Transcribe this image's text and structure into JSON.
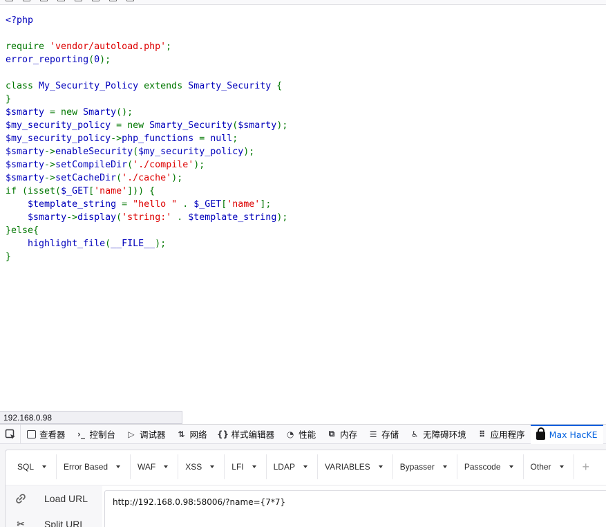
{
  "code_lines": [
    [
      {
        "c": "c-def",
        "t": "<?php"
      }
    ],
    [],
    [
      {
        "c": "c-kw",
        "t": "require "
      },
      {
        "c": "c-str",
        "t": "'vendor/autoload.php'"
      },
      {
        "c": "c-kw",
        "t": ";"
      }
    ],
    [
      {
        "c": "c-def",
        "t": "error_reporting"
      },
      {
        "c": "c-kw",
        "t": "("
      },
      {
        "c": "c-def",
        "t": "0"
      },
      {
        "c": "c-kw",
        "t": ");"
      }
    ],
    [],
    [
      {
        "c": "c-kw",
        "t": "class "
      },
      {
        "c": "c-def",
        "t": "My_Security_Policy "
      },
      {
        "c": "c-kw",
        "t": "extends "
      },
      {
        "c": "c-def",
        "t": "Smarty_Security "
      },
      {
        "c": "c-kw",
        "t": "{"
      }
    ],
    [
      {
        "c": "c-kw",
        "t": "}"
      }
    ],
    [
      {
        "c": "c-def",
        "t": "$smarty "
      },
      {
        "c": "c-kw",
        "t": "= new "
      },
      {
        "c": "c-def",
        "t": "Smarty"
      },
      {
        "c": "c-kw",
        "t": "();"
      }
    ],
    [
      {
        "c": "c-def",
        "t": "$my_security_policy "
      },
      {
        "c": "c-kw",
        "t": "= new "
      },
      {
        "c": "c-def",
        "t": "Smarty_Security"
      },
      {
        "c": "c-kw",
        "t": "("
      },
      {
        "c": "c-def",
        "t": "$smarty"
      },
      {
        "c": "c-kw",
        "t": ");"
      }
    ],
    [
      {
        "c": "c-def",
        "t": "$my_security_policy"
      },
      {
        "c": "c-kw",
        "t": "->"
      },
      {
        "c": "c-def",
        "t": "php_functions "
      },
      {
        "c": "c-kw",
        "t": "= "
      },
      {
        "c": "c-def",
        "t": "null"
      },
      {
        "c": "c-kw",
        "t": ";"
      }
    ],
    [
      {
        "c": "c-def",
        "t": "$smarty"
      },
      {
        "c": "c-kw",
        "t": "->"
      },
      {
        "c": "c-def",
        "t": "enableSecurity"
      },
      {
        "c": "c-kw",
        "t": "("
      },
      {
        "c": "c-def",
        "t": "$my_security_policy"
      },
      {
        "c": "c-kw",
        "t": ");"
      }
    ],
    [
      {
        "c": "c-def",
        "t": "$smarty"
      },
      {
        "c": "c-kw",
        "t": "->"
      },
      {
        "c": "c-def",
        "t": "setCompileDir"
      },
      {
        "c": "c-kw",
        "t": "("
      },
      {
        "c": "c-str",
        "t": "'./compile'"
      },
      {
        "c": "c-kw",
        "t": ");"
      }
    ],
    [
      {
        "c": "c-def",
        "t": "$smarty"
      },
      {
        "c": "c-kw",
        "t": "->"
      },
      {
        "c": "c-def",
        "t": "setCacheDir"
      },
      {
        "c": "c-kw",
        "t": "("
      },
      {
        "c": "c-str",
        "t": "'./cache'"
      },
      {
        "c": "c-kw",
        "t": ");"
      }
    ],
    [
      {
        "c": "c-kw",
        "t": "if (isset("
      },
      {
        "c": "c-def",
        "t": "$_GET"
      },
      {
        "c": "c-kw",
        "t": "["
      },
      {
        "c": "c-str",
        "t": "'name'"
      },
      {
        "c": "c-kw",
        "t": "])) {"
      }
    ],
    [
      {
        "c": "c-kw",
        "t": "    "
      },
      {
        "c": "c-def",
        "t": "$template_string "
      },
      {
        "c": "c-kw",
        "t": "= "
      },
      {
        "c": "c-str",
        "t": "\"hello \" "
      },
      {
        "c": "c-kw",
        "t": ". "
      },
      {
        "c": "c-def",
        "t": "$_GET"
      },
      {
        "c": "c-kw",
        "t": "["
      },
      {
        "c": "c-str",
        "t": "'name'"
      },
      {
        "c": "c-kw",
        "t": "];"
      }
    ],
    [
      {
        "c": "c-kw",
        "t": "    "
      },
      {
        "c": "c-def",
        "t": "$smarty"
      },
      {
        "c": "c-kw",
        "t": "->"
      },
      {
        "c": "c-def",
        "t": "display"
      },
      {
        "c": "c-kw",
        "t": "("
      },
      {
        "c": "c-str",
        "t": "'string:' "
      },
      {
        "c": "c-kw",
        "t": ". "
      },
      {
        "c": "c-def",
        "t": "$template_string"
      },
      {
        "c": "c-kw",
        "t": ");"
      }
    ],
    [
      {
        "c": "c-kw",
        "t": "}else{"
      }
    ],
    [
      {
        "c": "c-kw",
        "t": "    "
      },
      {
        "c": "c-def",
        "t": "highlight_file"
      },
      {
        "c": "c-kw",
        "t": "("
      },
      {
        "c": "c-def",
        "t": "__FILE__"
      },
      {
        "c": "c-kw",
        "t": ");"
      }
    ],
    [
      {
        "c": "c-kw",
        "t": "}"
      }
    ]
  ],
  "status_url": "192.168.0.98",
  "devtools": {
    "tabs": [
      {
        "name": "tab-inspector",
        "icon": "inspector-icon",
        "glyph": "▢",
        "label": "查看器"
      },
      {
        "name": "tab-console",
        "icon": "console-icon",
        "glyph": "›_",
        "label": "控制台"
      },
      {
        "name": "tab-debugger",
        "icon": "debugger-icon",
        "glyph": "▷",
        "label": "调试器"
      },
      {
        "name": "tab-network",
        "icon": "network-icon",
        "glyph": "⇅",
        "label": "网络"
      },
      {
        "name": "tab-style-editor",
        "icon": "style-editor-icon",
        "glyph": "{}",
        "label": "样式编辑器"
      },
      {
        "name": "tab-performance",
        "icon": "performance-icon",
        "glyph": "◔",
        "label": "性能"
      },
      {
        "name": "tab-memory",
        "icon": "memory-icon",
        "glyph": "⧉",
        "label": "内存"
      },
      {
        "name": "tab-storage",
        "icon": "storage-icon",
        "glyph": "☰",
        "label": "存储"
      },
      {
        "name": "tab-accessibility",
        "icon": "accessibility-icon",
        "glyph": "♿",
        "label": "无障碍环境"
      },
      {
        "name": "tab-application",
        "icon": "application-icon",
        "glyph": "⠿",
        "label": "应用程序"
      },
      {
        "name": "tab-max-hackbar",
        "icon": "lock-icon",
        "glyph": "",
        "label": "Max HacKE"
      }
    ]
  },
  "hackbar": {
    "menu": [
      "SQL",
      "Error Based",
      "WAF",
      "XSS",
      "LFI",
      "LDAP",
      "VARIABLES",
      "Bypasser",
      "Passcode",
      "Other"
    ],
    "load_url_label": "Load URL",
    "split_url_label": "Split URL",
    "url_value": "http://192.168.0.98:58006/?name={7*7}"
  }
}
